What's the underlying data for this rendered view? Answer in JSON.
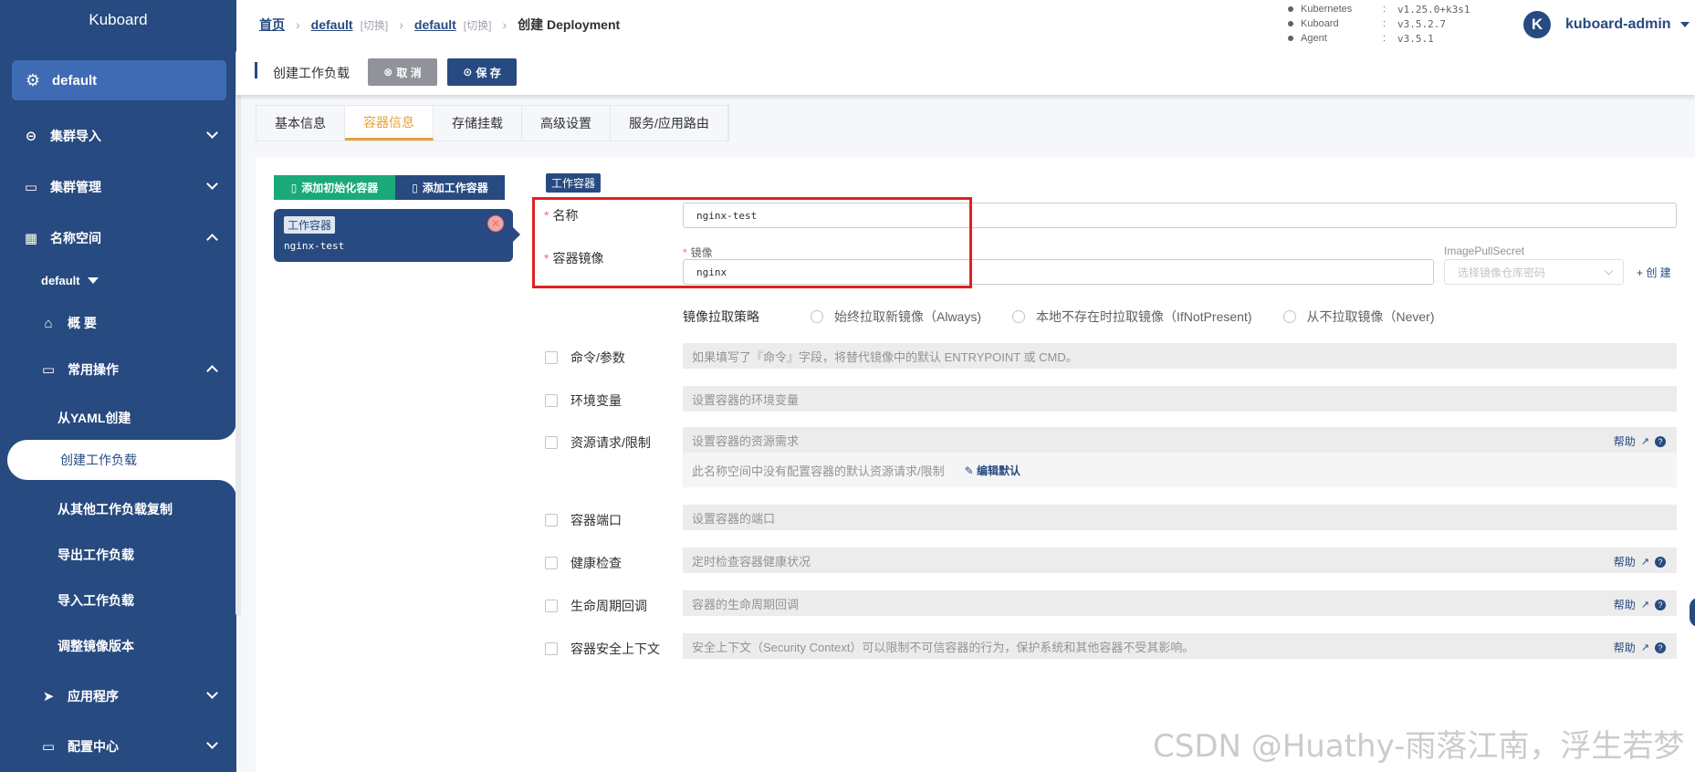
{
  "sidebar": {
    "brand": "Kuboard",
    "current_namespace": "default",
    "menu": {
      "cluster_import": "集群导入",
      "cluster_manage": "集群管理",
      "namespace": "名称空间",
      "ns_select": "default",
      "overview": "概 要",
      "common_ops": "常用操作",
      "from_yaml": "从YAML创建",
      "create_workload": "创建工作负载",
      "copy_workload": "从其他工作负载复制",
      "export_workload": "导出工作负载",
      "import_workload": "导入工作负载",
      "adjust_image": "调整镜像版本",
      "apps": "应用程序",
      "config_center": "配置中心"
    }
  },
  "header": {
    "breadcrumb": {
      "home": "首页",
      "cluster": "default",
      "cluster_switch": "[切换]",
      "namespace": "default",
      "namespace_switch": "[切换]",
      "current": "创建 Deployment"
    },
    "versions": [
      {
        "name": "Kubernetes",
        "value": "v1.25.0+k3s1"
      },
      {
        "name": "Kuboard",
        "value": "v3.5.2.7"
      },
      {
        "name": "Agent",
        "value": "v3.5.1"
      }
    ],
    "user": {
      "avatar_letter": "K",
      "name": "kuboard-admin"
    }
  },
  "toolbar": {
    "title": "创建工作负载",
    "cancel_label": "取 消",
    "save_label": "保 存"
  },
  "tabs": [
    "基本信息",
    "容器信息",
    "存储挂载",
    "高级设置",
    "服务/应用路由"
  ],
  "active_tab": "容器信息",
  "containers": {
    "add_init_label": "添加初始化容器",
    "add_work_label": "添加工作容器",
    "card_tag": "工作容器",
    "card_name": "nginx-test",
    "section_tag": "工作容器"
  },
  "form": {
    "name_label": "名称",
    "name_value": "nginx-test",
    "image_label": "容器镜像",
    "image_sub_label": "镜像",
    "image_value": "nginx",
    "pull_secret_label": "ImagePullSecret",
    "pull_secret_placeholder": "选择镜像仓库密码",
    "create_label": "创 建",
    "pull_policy_label": "镜像拉取策略",
    "pull_policy_options": [
      "始终拉取新镜像（Always)",
      "本地不存在时拉取镜像（IfNotPresent)",
      "从不拉取镜像（Never)"
    ],
    "options": [
      {
        "label": "命令/参数",
        "hint": "如果填写了『命令』字段，将替代镜像中的默认 ENTRYPOINT 或 CMD。",
        "help": ""
      },
      {
        "label": "环境变量",
        "hint": "设置容器的环境变量",
        "help": ""
      },
      {
        "label": "资源请求/限制",
        "hint": "设置容器的资源需求",
        "help": "帮助"
      },
      {
        "label": "容器端口",
        "hint": "设置容器的端口",
        "help": ""
      },
      {
        "label": "健康检查",
        "hint": "定时检查容器健康状况",
        "help": "帮助"
      },
      {
        "label": "生命周期回调",
        "hint": "容器的生命周期回调",
        "help": "帮助"
      },
      {
        "label": "容器安全上下文",
        "hint": "安全上下文（Security Context）可以限制不可信容器的行为，保护系统和其他容器不受其影响。",
        "help": "帮助"
      }
    ],
    "resource_note": "此名称空间中没有配置容器的默认资源请求/限制",
    "edit_default_label": "编辑默认"
  },
  "watermark": "CSDN @Huathy-雨落江南，浮生若梦",
  "colors": {
    "primary": "#274a80",
    "accent": "#e6a23c",
    "success": "#1aa97a",
    "highlight": "#e02020"
  }
}
